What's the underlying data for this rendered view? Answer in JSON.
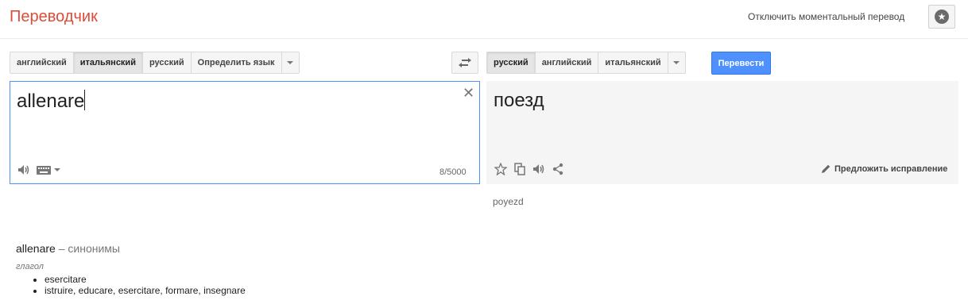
{
  "header": {
    "logo": "Переводчик",
    "instant_toggle": "Отключить моментальный перевод"
  },
  "source": {
    "languages": [
      "английский",
      "итальянский",
      "русский",
      "Определить язык"
    ],
    "selected": "итальянский",
    "text": "allenare",
    "char_count": "8/5000"
  },
  "target": {
    "languages": [
      "русский",
      "английский",
      "итальянский"
    ],
    "selected": "русский",
    "text": "поезд",
    "transliteration": "poyezd",
    "suggest_edit": "Предложить исправление"
  },
  "translate_button": "Перевести",
  "synonyms": {
    "word": "allenare",
    "label": "– синонимы",
    "part_of_speech": "глагол",
    "items": [
      "esercitare",
      "istruire, educare, esercitare, formare, insegnare"
    ]
  },
  "colors": {
    "logo": "#dd4b39",
    "primary_button": "#4d90fe",
    "focus_border": "#4d90fe",
    "target_panel_bg": "#f5f5f5"
  },
  "icons": [
    "star-circle-icon",
    "swap-icon",
    "close-icon",
    "speaker-icon",
    "keyboard-icon",
    "star-outline-icon",
    "copy-icon",
    "share-icon",
    "pencil-icon"
  ]
}
